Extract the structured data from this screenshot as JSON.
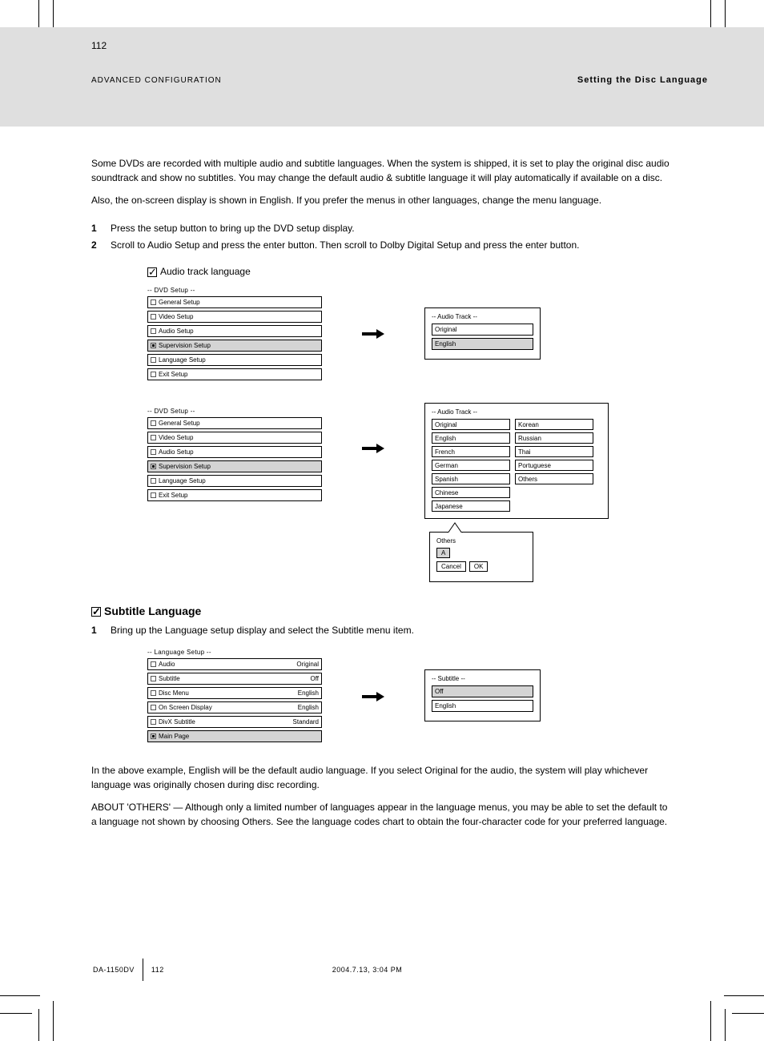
{
  "header": {
    "page_number": "112",
    "left": "ADVANCED CONFIGURATION",
    "right": "Setting the Disc Language"
  },
  "intro": {
    "p1": "Some DVDs are recorded with multiple audio and subtitle languages. When the system is shipped, it is set to play the original disc audio soundtrack and show no subtitles. You may change the default audio & subtitle language it will play automatically if available on a disc.",
    "p2": "Also, the on-screen display is shown in English. If you prefer the menus in other languages, change the menu language."
  },
  "steps": {
    "s1_num": "1",
    "s1_text": " Press the setup button to bring up the DVD setup display.",
    "s2_num": "2",
    "s2_text": " Scroll to Audio Setup and press the enter button. Then scroll to Dolby Digital Setup and press the enter button.",
    "tick_label": "Audio track language"
  },
  "menu1": {
    "title": "-- DVD Setup --",
    "rows": [
      {
        "label": "General Setup",
        "val": ""
      },
      {
        "label": "Video Setup",
        "val": ""
      },
      {
        "label": "Audio Setup",
        "val": ""
      },
      {
        "label": "Supervision Setup",
        "val": "",
        "sel": true
      },
      {
        "label": "Language Setup",
        "val": ""
      },
      {
        "label": "Exit Setup",
        "val": ""
      }
    ]
  },
  "audio_box": {
    "title": "-- Audio Track --",
    "rows": [
      {
        "label": "Original",
        "val": "",
        "sel": false
      },
      {
        "label": "English",
        "val": "",
        "sel": true
      }
    ]
  },
  "menu2": {
    "title": "-- DVD Setup --",
    "rows": [
      {
        "label": "General Setup",
        "val": ""
      },
      {
        "label": "Video Setup",
        "val": ""
      },
      {
        "label": "Audio Setup",
        "val": ""
      },
      {
        "label": "Supervision Setup",
        "val": "",
        "sel": true
      },
      {
        "label": "Language Setup",
        "val": ""
      },
      {
        "label": "Exit Setup",
        "val": ""
      }
    ]
  },
  "langbox": {
    "title": "-- Audio Track --",
    "col1": [
      "Original",
      "English",
      "French",
      "German",
      "Spanish",
      "Chinese",
      "Japanese"
    ],
    "col2": [
      "Korean",
      "Russian",
      "Thai",
      "Portuguese",
      "Others"
    ]
  },
  "other_box": {
    "title": "Others",
    "a_label": "A",
    "cancel": "Cancel",
    "ok": "OK"
  },
  "section2": {
    "title": "Subtitle Language",
    "step_num": "1",
    "step_text": " Bring up the Language setup display and select the Subtitle menu item."
  },
  "menu3": {
    "title": "-- Language Setup --",
    "rows": [
      {
        "label": "Audio",
        "val": "Original"
      },
      {
        "label": "Subtitle",
        "val": "Off"
      },
      {
        "label": "Disc Menu",
        "val": "English"
      },
      {
        "label": "On Screen Display",
        "val": "English"
      },
      {
        "label": "DivX Subtitle",
        "val": "Standard"
      },
      {
        "label": "Main Page",
        "val": "",
        "sel": true
      }
    ]
  },
  "subtitle_box": {
    "title": "-- Subtitle --",
    "rows": [
      {
        "label": "Off",
        "sel": true
      },
      {
        "label": "English",
        "sel": false
      }
    ]
  },
  "closing": {
    "p1": "In the above example, English will be the default audio language. If you select Original for the audio, the system will play whichever language was originally chosen during disc recording.",
    "p2": "ABOUT 'OTHERS' — Although only a limited number of languages appear in the language menus, you may be able to set the default to a language not shown by choosing Others. See the language codes chart to obtain the four-character code for your preferred language."
  },
  "footer": {
    "model": "DA-1150DV",
    "date": "2004.7.13, 3:04 PM",
    "page": "112"
  }
}
